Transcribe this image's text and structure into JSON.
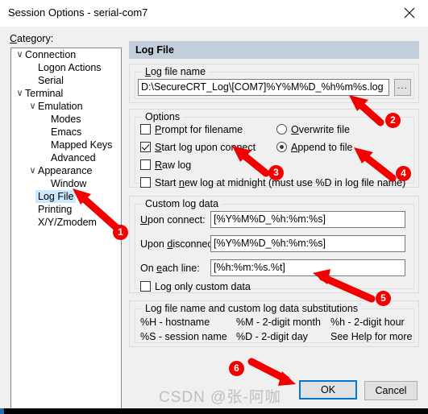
{
  "window": {
    "title": "Session Options - serial-com7",
    "close_icon": "close-icon"
  },
  "sidebar": {
    "label": "Category:",
    "items": [
      {
        "label": "Connection",
        "indent": 0,
        "chevron": "∨",
        "selected": false
      },
      {
        "label": "Logon Actions",
        "indent": 1,
        "chevron": "",
        "selected": false
      },
      {
        "label": "Serial",
        "indent": 1,
        "chevron": "",
        "selected": false
      },
      {
        "label": "Terminal",
        "indent": 0,
        "chevron": "∨",
        "selected": false
      },
      {
        "label": "Emulation",
        "indent": 1,
        "chevron": "∨",
        "selected": false
      },
      {
        "label": "Modes",
        "indent": 2,
        "chevron": "",
        "selected": false
      },
      {
        "label": "Emacs",
        "indent": 2,
        "chevron": "",
        "selected": false
      },
      {
        "label": "Mapped Keys",
        "indent": 2,
        "chevron": "",
        "selected": false
      },
      {
        "label": "Advanced",
        "indent": 2,
        "chevron": "",
        "selected": false
      },
      {
        "label": "Appearance",
        "indent": 1,
        "chevron": "∨",
        "selected": false
      },
      {
        "label": "Window",
        "indent": 2,
        "chevron": "",
        "selected": false
      },
      {
        "label": "Log File",
        "indent": 1,
        "chevron": "",
        "selected": true
      },
      {
        "label": "Printing",
        "indent": 1,
        "chevron": "",
        "selected": false
      },
      {
        "label": "X/Y/Zmodem",
        "indent": 1,
        "chevron": "",
        "selected": false
      }
    ]
  },
  "main": {
    "header": "Log File",
    "logfile_group": {
      "title": "Log file name",
      "value": "D:\\SecureCRT_Log\\[COM7]%Y%M%D_%h%m%s.log",
      "browse_label": "...",
      "browse_icon": "ellipsis-icon"
    },
    "options_group": {
      "title": "Options",
      "checkboxes": [
        {
          "label": "Prompt for filename",
          "checked": false
        },
        {
          "label": "Start log upon connect",
          "checked": true
        },
        {
          "label": "Raw log",
          "checked": false
        },
        {
          "label": "Start new log at midnight (must use %D in log file name)",
          "checked": false
        }
      ],
      "radios": [
        {
          "label": "Overwrite file",
          "checked": false
        },
        {
          "label": "Append to file",
          "checked": true
        }
      ]
    },
    "custom_group": {
      "title": "Custom log data",
      "fields": [
        {
          "label": "Upon connect:",
          "value": "[%Y%M%D_%h:%m:%s]"
        },
        {
          "label": "Upon disconnect:",
          "value": "[%Y%M%D_%h:%m:%s]"
        },
        {
          "label": "On each line:",
          "value": "[%h:%m:%s.%t]"
        }
      ],
      "checkbox": {
        "label": "Log only custom data",
        "checked": false
      }
    },
    "subs_group": {
      "title": "Log file name and custom log data substitutions",
      "row1": [
        "%H - hostname",
        "%M - 2-digit month",
        "%h - 2-digit hour"
      ],
      "row2": [
        "%S - session name",
        "%D - 2-digit day",
        "See Help for more"
      ]
    }
  },
  "footer": {
    "ok_label": "OK",
    "cancel_label": "Cancel"
  },
  "annotations": {
    "badges": [
      "1",
      "2",
      "3",
      "4",
      "5",
      "6"
    ],
    "color": "#f20000"
  },
  "watermark": {
    "text": "CSDN @张-阿咖"
  }
}
